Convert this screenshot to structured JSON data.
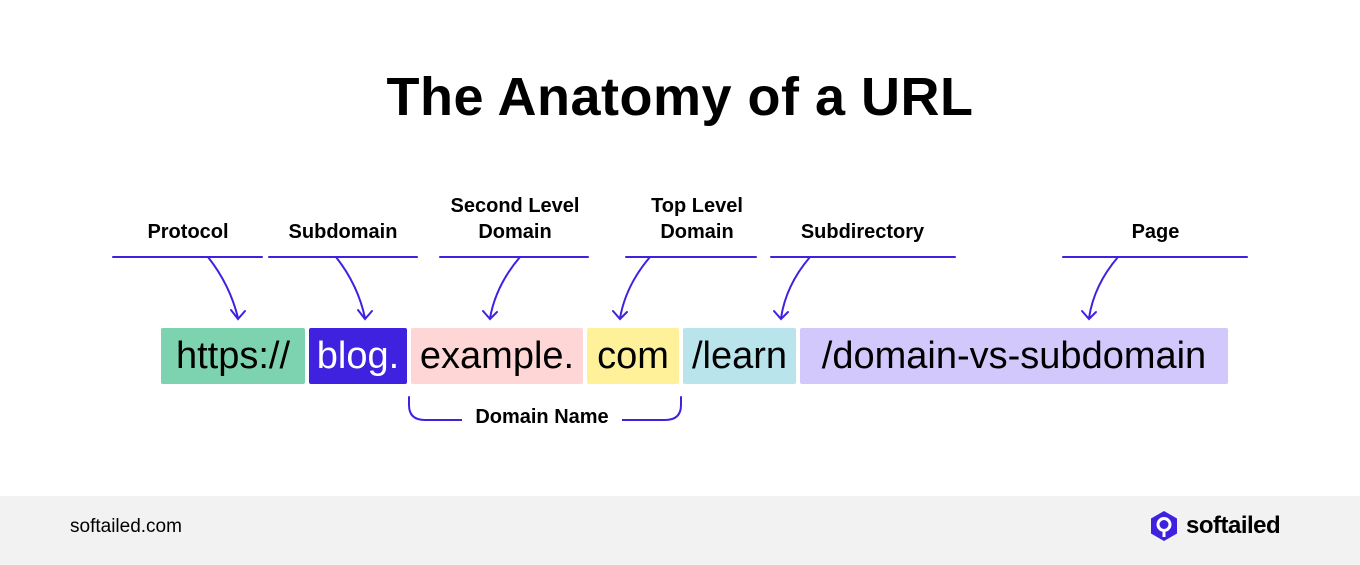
{
  "title": "The Anatomy of a URL",
  "labels": {
    "protocol": "Protocol",
    "subdomain": "Subdomain",
    "sld_line1": "Second Level",
    "sld_line2": "Domain",
    "tld_line1": "Top Level",
    "tld_line2": "Domain",
    "subdirectory": "Subdirectory",
    "page": "Page",
    "domain_name": "Domain Name"
  },
  "segments": [
    {
      "text": "https://",
      "color": "#7dd3b0",
      "text_color": "#000000"
    },
    {
      "text": "blog.",
      "color": "#3f22e0",
      "text_color": "#ffffff"
    },
    {
      "text": "example.",
      "color": "#ffd6d6",
      "text_color": "#000000"
    },
    {
      "text": "com",
      "color": "#fff199",
      "text_color": "#000000"
    },
    {
      "text": "/learn",
      "color": "#b9e4ec",
      "text_color": "#000000"
    },
    {
      "text": "/domain-vs-subdomain",
      "color": "#d3c8fb",
      "text_color": "#000000"
    }
  ],
  "accent_color": "#3f22e0",
  "footer": {
    "site": "softailed.com",
    "brand": "softailed"
  }
}
